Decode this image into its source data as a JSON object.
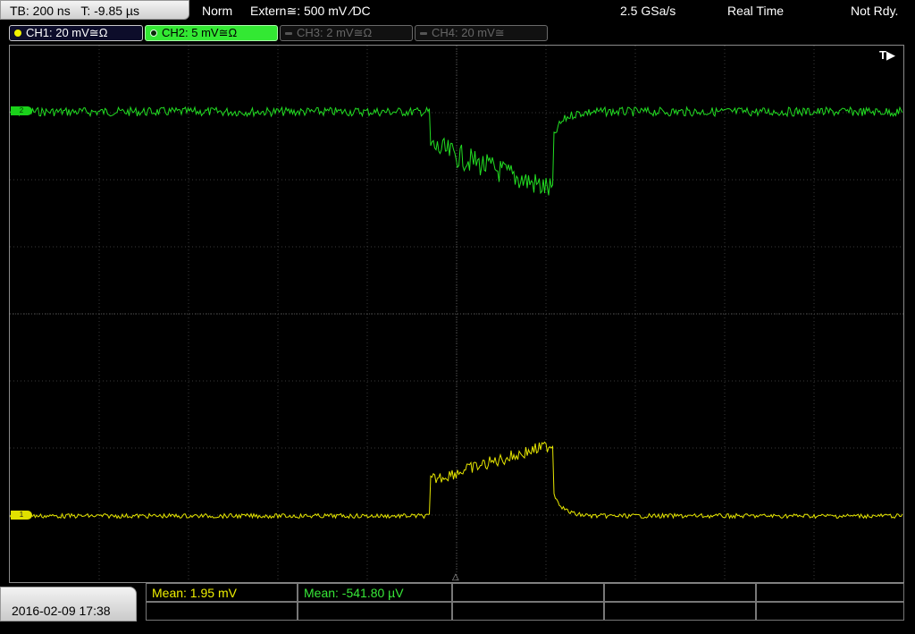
{
  "header": {
    "timebase": "TB: 200 ns",
    "trigger_time": "T: -9.85 µs",
    "trigger_mode": "Norm",
    "trigger_source": "Extern≅: 500 mV ⁄DC",
    "sample_rate": "2.5 GSa/s",
    "acq_mode": "Real Time",
    "status": "Not Rdy."
  },
  "channels": [
    {
      "label": "CH1: 20 mV≅Ω",
      "active": true,
      "color": "#f0f000"
    },
    {
      "label": "CH2: 5 mV≅Ω",
      "active": true,
      "color": "#33e833"
    },
    {
      "label": "CH3: 2 mV≅Ω",
      "active": false,
      "color": "#666666"
    },
    {
      "label": "CH4: 20 mV≅",
      "active": false,
      "color": "#666666"
    }
  ],
  "markers": {
    "trigger": "T▶",
    "ch2_ref": "2",
    "ch1_ref": "1",
    "trigger_pos": "△"
  },
  "footer": {
    "datetime": "2016-02-09 17:38",
    "measurements": [
      {
        "label": "Mean: 1.95 mV",
        "color": "#f0f000"
      },
      {
        "label": "Mean: -541.80 µV",
        "color": "#38e838"
      }
    ]
  }
}
